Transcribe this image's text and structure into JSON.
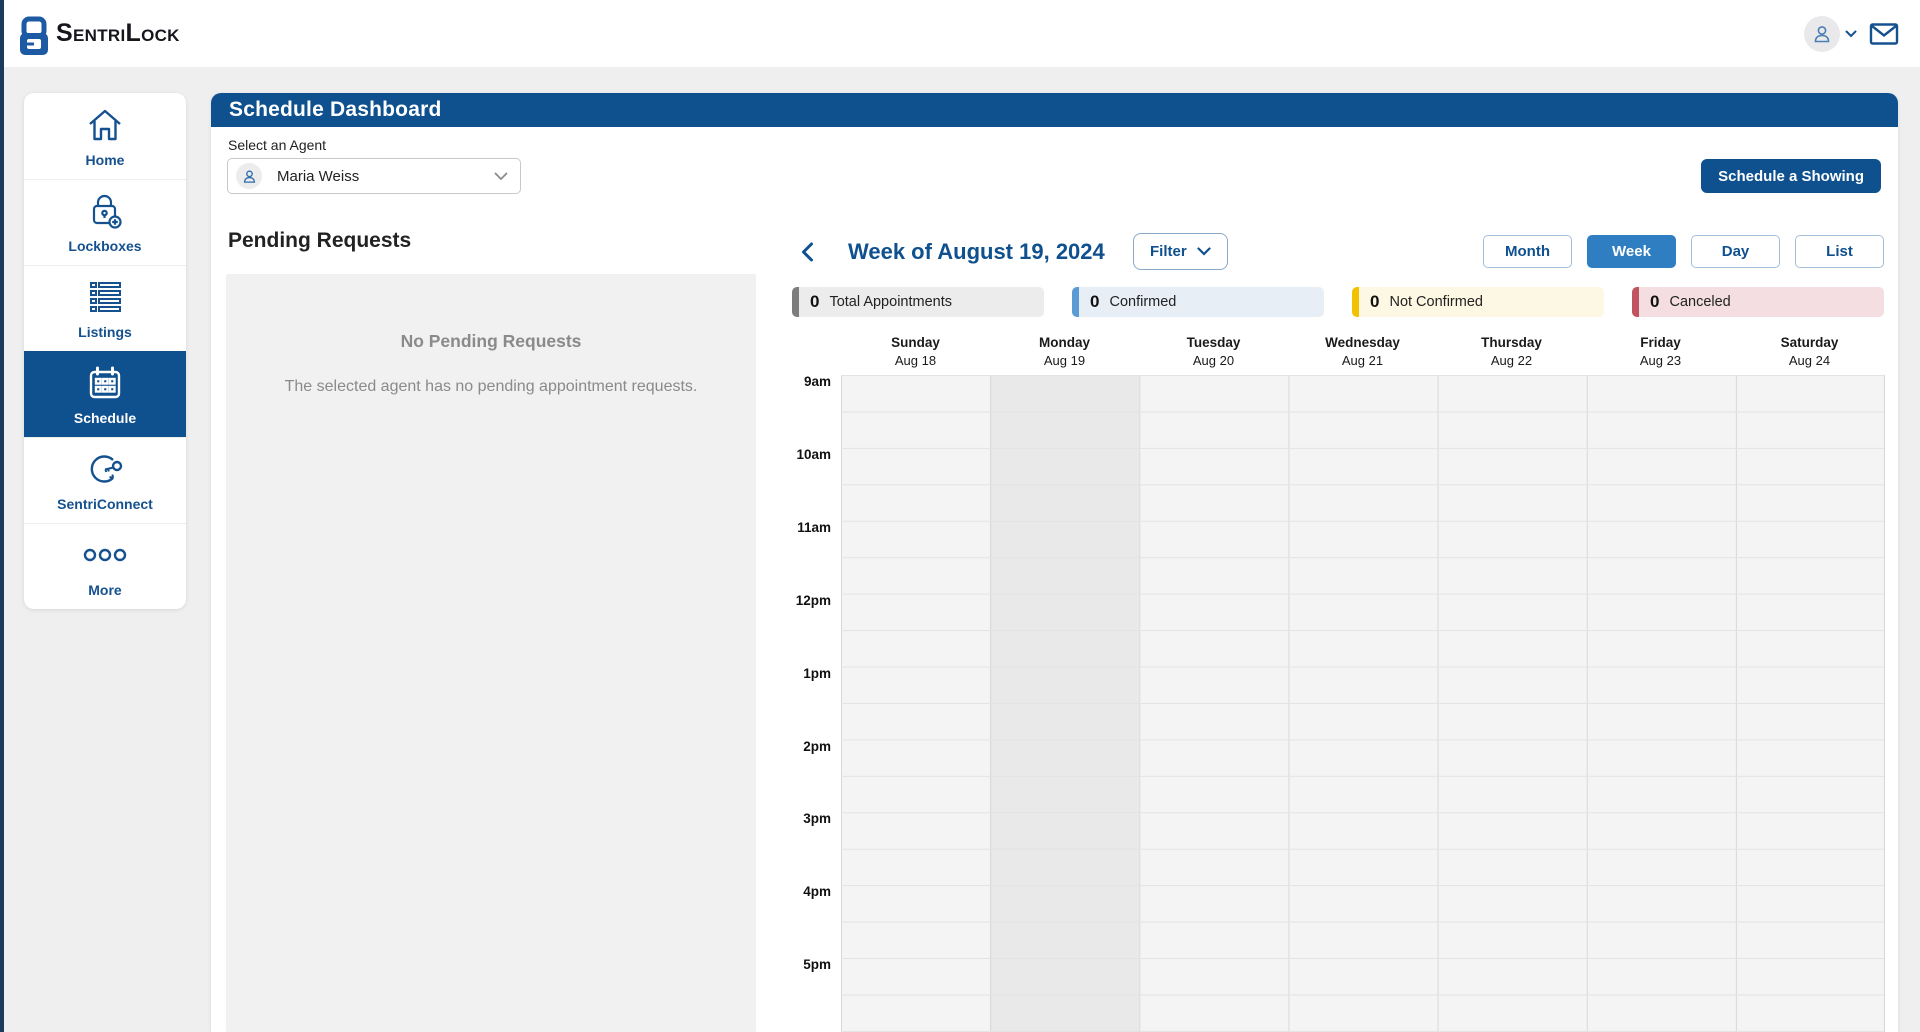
{
  "brand": {
    "part1": "Sentri",
    "part2": "Lock"
  },
  "topbar": {
    "user_menu_icon": "user-avatar",
    "mail_icon": "mail"
  },
  "sidebar": {
    "items": [
      {
        "label": "Home",
        "icon": "home-icon",
        "active": false
      },
      {
        "label": "Lockboxes",
        "icon": "lockbox-icon",
        "active": false
      },
      {
        "label": "Listings",
        "icon": "listings-icon",
        "active": false
      },
      {
        "label": "Schedule",
        "icon": "schedule-icon",
        "active": true
      },
      {
        "label": "SentriConnect",
        "icon": "sentriconnect-icon",
        "active": false
      },
      {
        "label": "More",
        "icon": "more-icon",
        "active": false
      }
    ]
  },
  "header": {
    "title": "Schedule Dashboard"
  },
  "agent_select": {
    "label": "Select an Agent",
    "value": "Maria Weiss"
  },
  "actions": {
    "schedule_showing": "Schedule a Showing"
  },
  "pending": {
    "title": "Pending Requests",
    "empty_title": "No Pending Requests",
    "empty_message": "The selected agent has no pending appointment requests."
  },
  "calendar": {
    "week_title": "Week of August 19, 2024",
    "filter_label": "Filter",
    "views": [
      {
        "label": "Month",
        "active": false
      },
      {
        "label": "Week",
        "active": true
      },
      {
        "label": "Day",
        "active": false
      },
      {
        "label": "List",
        "active": false
      }
    ],
    "stats": [
      {
        "count": "0",
        "label": "Total Appointments",
        "bar": "#7d7d7d",
        "bg": "#ececec"
      },
      {
        "count": "0",
        "label": "Confirmed",
        "bar": "#5b9bd5",
        "bg": "#e7eef6"
      },
      {
        "count": "0",
        "label": "Not Confirmed",
        "bar": "#f2c200",
        "bg": "#fcf8e3"
      },
      {
        "count": "0",
        "label": "Canceled",
        "bar": "#c05460",
        "bg": "#f4dee1"
      }
    ],
    "days": [
      {
        "name": "Sunday",
        "date": "Aug 18",
        "today": false
      },
      {
        "name": "Monday",
        "date": "Aug 19",
        "today": true
      },
      {
        "name": "Tuesday",
        "date": "Aug 20",
        "today": false
      },
      {
        "name": "Wednesday",
        "date": "Aug 21",
        "today": false
      },
      {
        "name": "Thursday",
        "date": "Aug 22",
        "today": false
      },
      {
        "name": "Friday",
        "date": "Aug 23",
        "today": false
      },
      {
        "name": "Saturday",
        "date": "Aug 24",
        "today": false
      }
    ],
    "times": [
      "9am",
      "10am",
      "11am",
      "12pm",
      "1pm",
      "2pm",
      "3pm",
      "4pm",
      "5pm"
    ]
  },
  "colors": {
    "primary_dark_blue": "#0f508f",
    "active_view_blue": "#2f7ec2",
    "page_background": "#efeff0",
    "grid_line": "#d8d8d8",
    "today_column": "#e9e9e9"
  }
}
